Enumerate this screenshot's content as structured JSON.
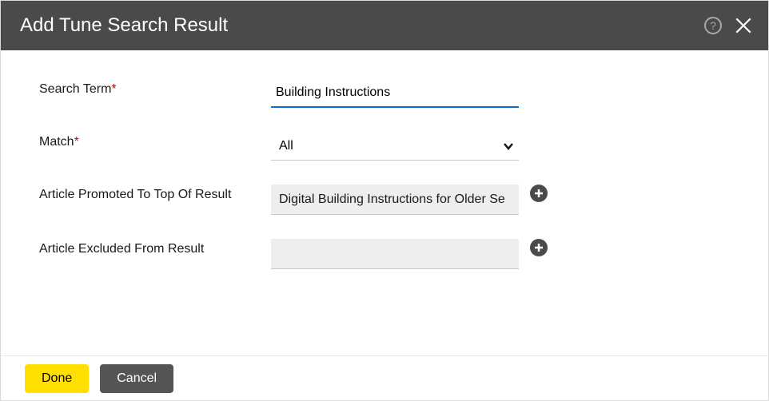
{
  "title": "Add Tune Search Result",
  "fields": {
    "searchTerm": {
      "label": "Search Term",
      "required": "*",
      "value": "Building Instructions"
    },
    "match": {
      "label": "Match",
      "required": "*",
      "value": "All"
    },
    "promoted": {
      "label": "Article Promoted To Top Of Result",
      "value": "Digital Building Instructions for Older Se"
    },
    "excluded": {
      "label": "Article Excluded From Result",
      "value": ""
    }
  },
  "footer": {
    "done": "Done",
    "cancel": "Cancel"
  }
}
